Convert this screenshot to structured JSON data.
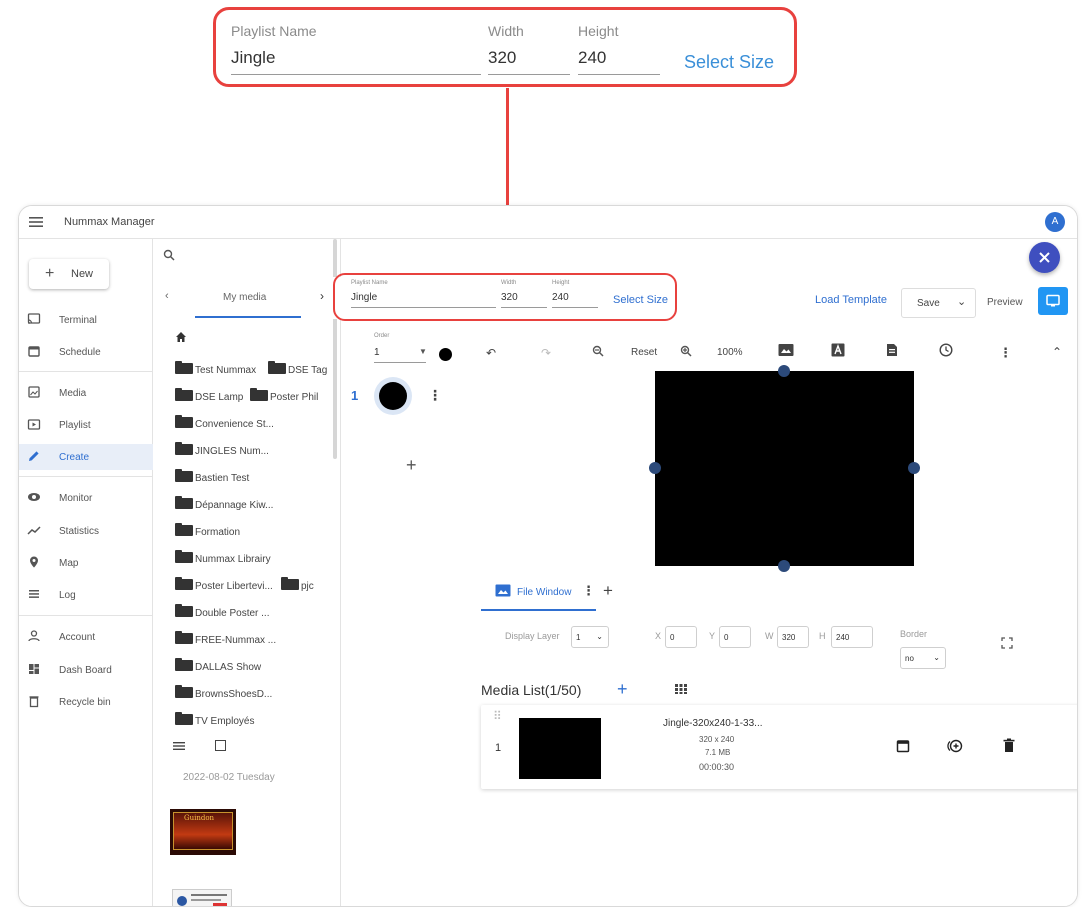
{
  "zoom": {
    "playlist_name_label": "Playlist Name",
    "playlist_name_value": "Jingle",
    "width_label": "Width",
    "width_value": "320",
    "height_label": "Height",
    "height_value": "240",
    "select_size": "Select Size"
  },
  "app": {
    "title": "Nummax Manager",
    "avatar_initial": "A"
  },
  "sidebar": {
    "new_label": "New",
    "items": [
      {
        "label": "Terminal",
        "icon": "cast-icon"
      },
      {
        "label": "Schedule",
        "icon": "calendar-icon"
      },
      {
        "label": "Media",
        "icon": "image-icon"
      },
      {
        "label": "Playlist",
        "icon": "playlist-icon"
      },
      {
        "label": "Create",
        "icon": "pencil-icon",
        "active": true
      },
      {
        "label": "Monitor",
        "icon": "eye-icon"
      },
      {
        "label": "Statistics",
        "icon": "trend-icon"
      },
      {
        "label": "Map",
        "icon": "pin-icon"
      },
      {
        "label": "Log",
        "icon": "list-icon"
      },
      {
        "label": "Account",
        "icon": "person-icon"
      },
      {
        "label": "Dash Board",
        "icon": "dashboard-icon"
      },
      {
        "label": "Recycle bin",
        "icon": "trash-icon"
      }
    ]
  },
  "media_panel": {
    "tab_label": "My media",
    "folders": [
      "Test Nummax",
      "DSE Tag",
      "DSE Lamp",
      "Poster Phil",
      "Convenience St...",
      "JINGLES Num...",
      "Bastien Test",
      "Dépannage Kiw...",
      "Formation",
      "Nummax Librairy",
      "Poster Libertevi...",
      "pjc",
      "Double Poster ...",
      "FREE-Nummax ...",
      "DALLAS Show",
      "BrownsShoesD...",
      "TV Employés"
    ],
    "date": "2022-08-02 Tuesday",
    "thumb1_text": "Guindon"
  },
  "editor": {
    "playlist_name_label": "Playlist Name",
    "playlist_name_value": "Jingle",
    "width_label": "Width",
    "width_value": "320",
    "height_label": "Height",
    "height_value": "240",
    "select_size": "Select Size",
    "load_template": "Load Template",
    "save": "Save",
    "preview": "Preview",
    "order_label": "Order",
    "order_value": "1",
    "reset": "Reset",
    "zoom_level": "100%",
    "layer_number": "1",
    "file_window_tab": "File Window",
    "display_layer_label": "Display Layer",
    "display_layer_value": "1",
    "x_label": "X",
    "x_value": "0",
    "y_label": "Y",
    "y_value": "0",
    "w_label": "W",
    "w_value": "320",
    "h_label": "H",
    "h_value": "240",
    "border_label": "Border",
    "border_value": "no",
    "media_list_title": "Media List(1/50)",
    "media_item": {
      "index": "1",
      "name": "Jingle-320x240-1-33...",
      "size": "320 x 240",
      "file_size": "7.1 MB",
      "duration": "00:00:30"
    }
  },
  "colors": {
    "accent": "#2f6fd0",
    "callout_red": "#e8413e",
    "fab_close": "#3f4fbf",
    "preview_btn": "#2196f3"
  }
}
